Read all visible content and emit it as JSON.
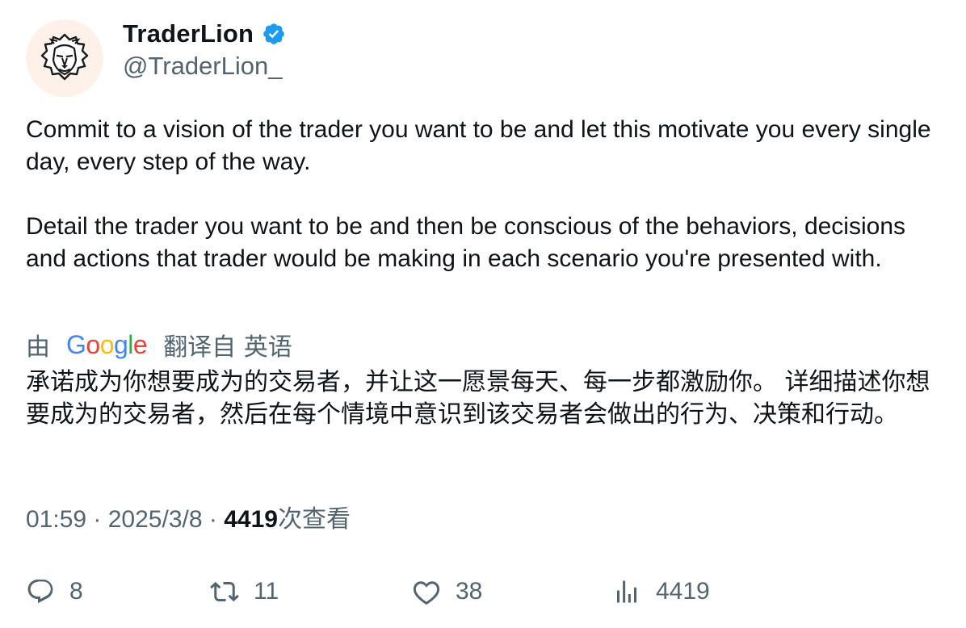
{
  "author": {
    "display_name": "TraderLion",
    "handle": "@TraderLion_",
    "verified": true,
    "avatar_icon": "lion-head-icon"
  },
  "tweet": {
    "paragraphs": [
      "Commit to a vision of the trader you want to be and let this motivate you every single day, every step of the way.",
      "Detail the trader you want to be and then be conscious of the behaviors, decisions and actions that trader would be making in each scenario you're presented with."
    ]
  },
  "translation": {
    "prefix": "由",
    "provider": "Google",
    "provider_letters": [
      "G",
      "o",
      "o",
      "g",
      "l",
      "e"
    ],
    "suffix": "翻译自 英语",
    "text": "承诺成为你想要成为的交易者，并让这一愿景每天、每一步都激励你。 详细描述你想要成为的交易者，然后在每个情境中意识到该交易者会做出的行为、决策和行动。"
  },
  "meta": {
    "time": "01:59",
    "separator": " · ",
    "date": "2025/3/8",
    "views_count": "4419",
    "views_label": "次查看"
  },
  "actions": {
    "replies": "8",
    "retweets": "11",
    "likes": "38",
    "views": "4419"
  },
  "colors": {
    "text_primary": "#0f1419",
    "text_secondary": "#536471",
    "verified_blue": "#1d9bf0",
    "avatar_bg": "#fdf1ea"
  }
}
